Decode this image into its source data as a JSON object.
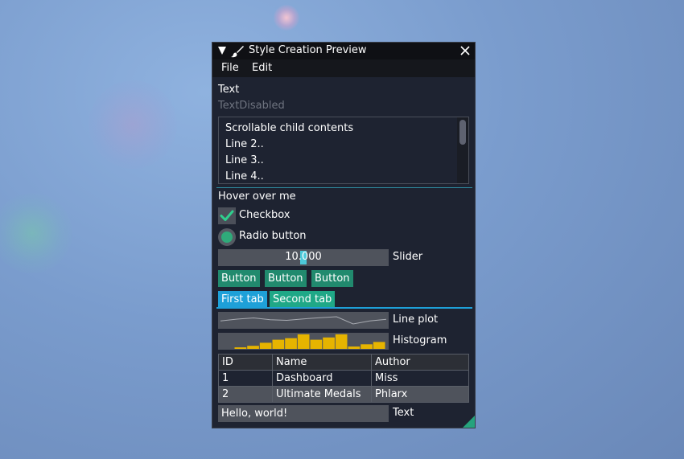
{
  "window": {
    "title": "Style Creation Preview",
    "icons": {
      "collapse": "collapse-triangle-icon",
      "brush": "paint-brush-icon",
      "close": "close-icon"
    }
  },
  "menu": {
    "items": [
      "File",
      "Edit"
    ]
  },
  "text": {
    "normal": "Text",
    "disabled": "TextDisabled"
  },
  "child_window": {
    "lines": [
      "Scrollable child contents",
      "Line 2..",
      "Line 3..",
      "Line 4.."
    ]
  },
  "hover_text": "Hover over me",
  "checkbox": {
    "label": "Checkbox",
    "checked": true
  },
  "radio": {
    "label": "Radio button",
    "selected": true
  },
  "slider": {
    "value_text": "10.000",
    "label": "Slider"
  },
  "buttons": [
    "Button",
    "Button",
    "Button"
  ],
  "tabs": [
    {
      "label": "First tab",
      "active": true
    },
    {
      "label": "Second tab",
      "active": false
    }
  ],
  "line_plot": {
    "label": "Line plot",
    "values": [
      0.45,
      0.6,
      0.7,
      0.55,
      0.5,
      0.62,
      0.72,
      0.8,
      0.2,
      0.45,
      0.58
    ]
  },
  "histogram": {
    "label": "Histogram",
    "values": [
      0.1,
      0.2,
      0.4,
      0.6,
      0.7,
      0.95,
      0.6,
      0.75,
      0.95,
      0.15,
      0.3,
      0.45
    ]
  },
  "table": {
    "headers": [
      "ID",
      "Name",
      "Author"
    ],
    "rows": [
      [
        "1",
        "Dashboard",
        "Miss"
      ],
      [
        "2",
        "Ultimate Medals",
        "Phlarx"
      ]
    ]
  },
  "input": {
    "value": "Hello, world!",
    "label": "Text"
  },
  "colors": {
    "accent": "#1ea0d8",
    "button": "#218a6e",
    "histogram": "#e6b400",
    "window_bg": "#1e2331"
  }
}
